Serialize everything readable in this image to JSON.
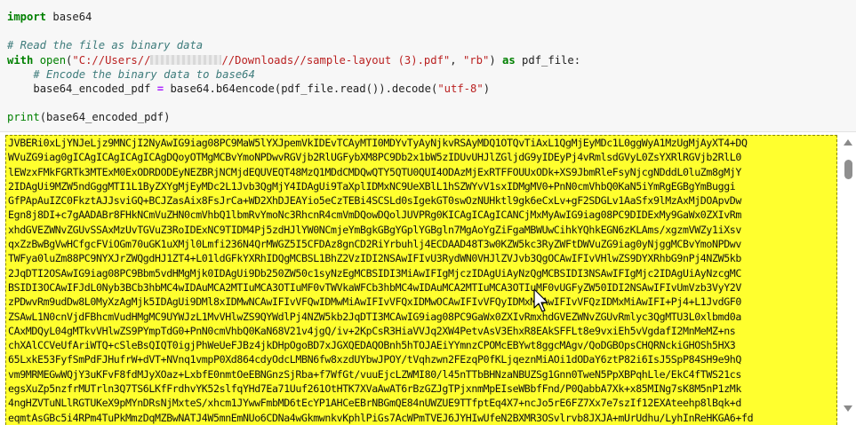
{
  "code_cell": {
    "lines": [
      {
        "import_kw": "import",
        "module": " base64"
      },
      {},
      {
        "comment": "# Read the file as binary data"
      },
      {
        "with_kw": "with",
        "open_fn": " open",
        "paren_open": "(",
        "path_prefix": "\"C://Users//",
        "path_suffix": "//Downloads//sample-layout (3).pdf\"",
        "comma": ", ",
        "mode": "\"rb\"",
        "paren_close": ") ",
        "as_kw": "as",
        "var": " pdf_file:"
      },
      {
        "indent": "    ",
        "comment": "# Encode the binary data to base64"
      },
      {
        "indent": "    ",
        "lhs": "base64_encoded_pdf ",
        "eq": "=",
        "rhs": " base64.b64encode(pdf_file.read()).decode(",
        "enc": "\"utf-8\"",
        "close": ")"
      },
      {},
      {
        "print_fn": "print",
        "args": "(base64_encoded_pdf)"
      }
    ]
  },
  "output": {
    "lines": [
      "JVBERi0xLjYNJeLjz9MNCjI2NyAwIG9iag08PC9MaW5lYXJpemVkIDEvTCAyMTI0MDYvTyAyNjkvRSAyMDQ1OTQvTiAxL1QgMjEyMDc1L0ggWyA1MzUgMjAyXT4+DQ",
      "WVuZG9iag0gICAgICAgICAgICAgDQoyOTMgMCBvYmoNPDwvRGVjb2RlUGFybXM8PC9Db2x1bW5zIDUvUHJlZGljdG9yIDEyPj4vRmlsdGVyL0ZsYXRlRGVjb2RlL0",
      "lEWzxFMkFGRTk3MTExM0ExODRDODEyNEZBRjNCMjdEQUVEQT48MzQ1MDdCMDQwQTY5QTU0QUI4ODAzMjExRTFFOUUxODk+XS9JbmRleFsyNjcgNDddL0luZm8gMjY",
      "2IDAgUi9MZW5ndGggMTI1L1ByZXYgMjEyMDc2L1Jvb3QgMjY4IDAgUi9TaXplIDMxNC9UeXBlL1hSZWYvV1sxIDMgMV0+PnN0cmVhbQ0KaN5iYmRgEGBgYmBuggi",
      "GfPApAuIZC0FkztAJJsviGQ+BCJZasAix8FsJrCa+WD2XhDJEAYio5eCzTEBi4SCSLd0sIgekGT0swOzNUHktl9gk6eCxLv+gF2SDGLv1AaSfx9lMzAxMjDOApvDw",
      "Egn8j8DI+c7gAADABr8FHkNCmVuZHN0cmVhbQ1lbmRvYmoNc3RhcnR4cmVmDQowDQolJUVPRg0KICAgICAgICANCjMxMyAwIG9iag08PC9DIDExMy9GaWx0ZXIvRm",
      "xhdGVEZWNvZGUvSSAxMzUvTGVuZ3RoIDExNC9TIDM4Pj5zdHJlYW0NCmjeYmBgkGBgYGplYGBgln7MgAoYgZiFgaMBWUwCihkYQhkEGN6zKLAms/xgzmVWZy1iXsv",
      "qxZzBwBgVwHCfgcFViOGm70uGK1uXMjl0Lmfi236N4QrMWGZ5I5CFDAz8gnCD2RiYrbuhlj4ECDAAD48T3w0KZW5kc3RyZWFtDWVuZG9iag0yNjggMCBvYmoNPDwv",
      "TWFya0luZm88PC9NYXJrZWQgdHJ1ZT4+L01ldGFkYXRhIDQgMCBSL1BhZ2VzIDI2NSAwIFIvU3RydWN0VHJlZVJvb3QgOCAwIFIvVHlwZS9DYXRhbG9nPj4NZW5kb",
      "2JqDTI2OSAwIG9iag08PC9Bbm5vdHMgMjk0IDAgUi9Db250ZW50c1syNzEgMCBSIDI3MiAwIFIgMjczIDAgUiAyNzQgMCBSIDI3NSAwIFIgMjc2IDAgUiAyNzcgMC",
      "BSIDI3OCAwIFJdL0Nyb3BCb3hbMC4wIDAuMCA2MTIuMCA3OTIuMF0vTWVkaWFCb3hbMC4wIDAuMCA2MTIuMCA3OTIuMF0vUGFyZW50IDI2NSAwIFIvUmVzb3VyY2V",
      "zPDwvRm9udDw8L0MyXzAgMjk5IDAgUi9DMl8xIDMwNCAwIFIvVFQwIDMwMiAwIFIvVFQxIDMwOCAwIFIvVFQyIDMxMiAwIFIvVFQzIDMxMiAwIFI+Pj4+L1JvdGF0",
      "ZSAwL1N0cnVjdFBhcmVudHMgMC9UYWJzL1MvVHlwZS9QYWdlPj4NZW5kb2JqDTI3MCAwIG9iag08PC9GaWx0ZXIvRmxhdGVEZWNvZGUvRmlyc3QgMTU3L0xlbmd0a",
      "CAxMDQyL04gMTkvVHlwZS9PYmpTdG0+PnN0cmVhbQ0KaN68V21v4jgQ/iv+2KpCsR3HiaVVJq2XW4PetvAsV3EhxR8EAkSFFLt8e9vxiEh5vVgdafI2MnMeMZ+ns",
      "chXAlCCVeUfAriWTQ+cSleBsQIQT0igjPhWeUeFJBz4jkDHpOgoBD7xJGXQEDAQOBnh5hTOJAEiYYmnzCPOMcEBYwt8ggcMAgv/QoDGBOpsCHQRNckiGHOSh5HX3",
      "65LxkE53FyfSmPdFJHufrW+dVT+NVnq1vmpP0Xd864cdyOdcLMBN6fw8xzdUYbwJPOY/tVqhzwn2FEzqP0fKLjqeznMiAOi1dODaY6ztP82i6IsJ5SpP84SH9e9hQ",
      "vm9MRMEGwWQjY3uKFvF8fdMJyXOaz+LxbfE0nmtOeEBNGnzSjRba+f7WfGt/vuuEjcLZWMI80/l45nTTbBHNzaNBUZSg1Gnn0TweN5PpXBPqhLle/EkC4fTWS21cs",
      "egsXuZp5nzfrMUTrln3Q7TS6LKfFrdhvYK52slfqYHd7Ea71Uuf261OtHTK7XVaAwAT6rBzGZJgTPjxnmMpEIseWBbfFnd/P0QabbA7Xk+x85MINg7sK8M5nP1zMk",
      "4ngHZVTuNLlRGTUKeX9pMYnDRsNjMxteS/xhcm1JYwwFmbMD6tEcYP1AHCeEBrNBGmQE84nUWZUE9TTfptEq4X7+ncJo5rE6FZ7Xx7e7szIf12EXAteehp8lBqk+d",
      "eqmtAsGBc5i4RPm4TuPkMmzDqMZBwNATJ4W5mnEmNUo6CDNa4wGkmwnkvKphlPiGs7AcWPmTVEJ6JYHIwUfeN2BXMR3OSvlrvb8JXJA+mUrUdhu/LyhInReHKGA6+fd"
    ]
  }
}
